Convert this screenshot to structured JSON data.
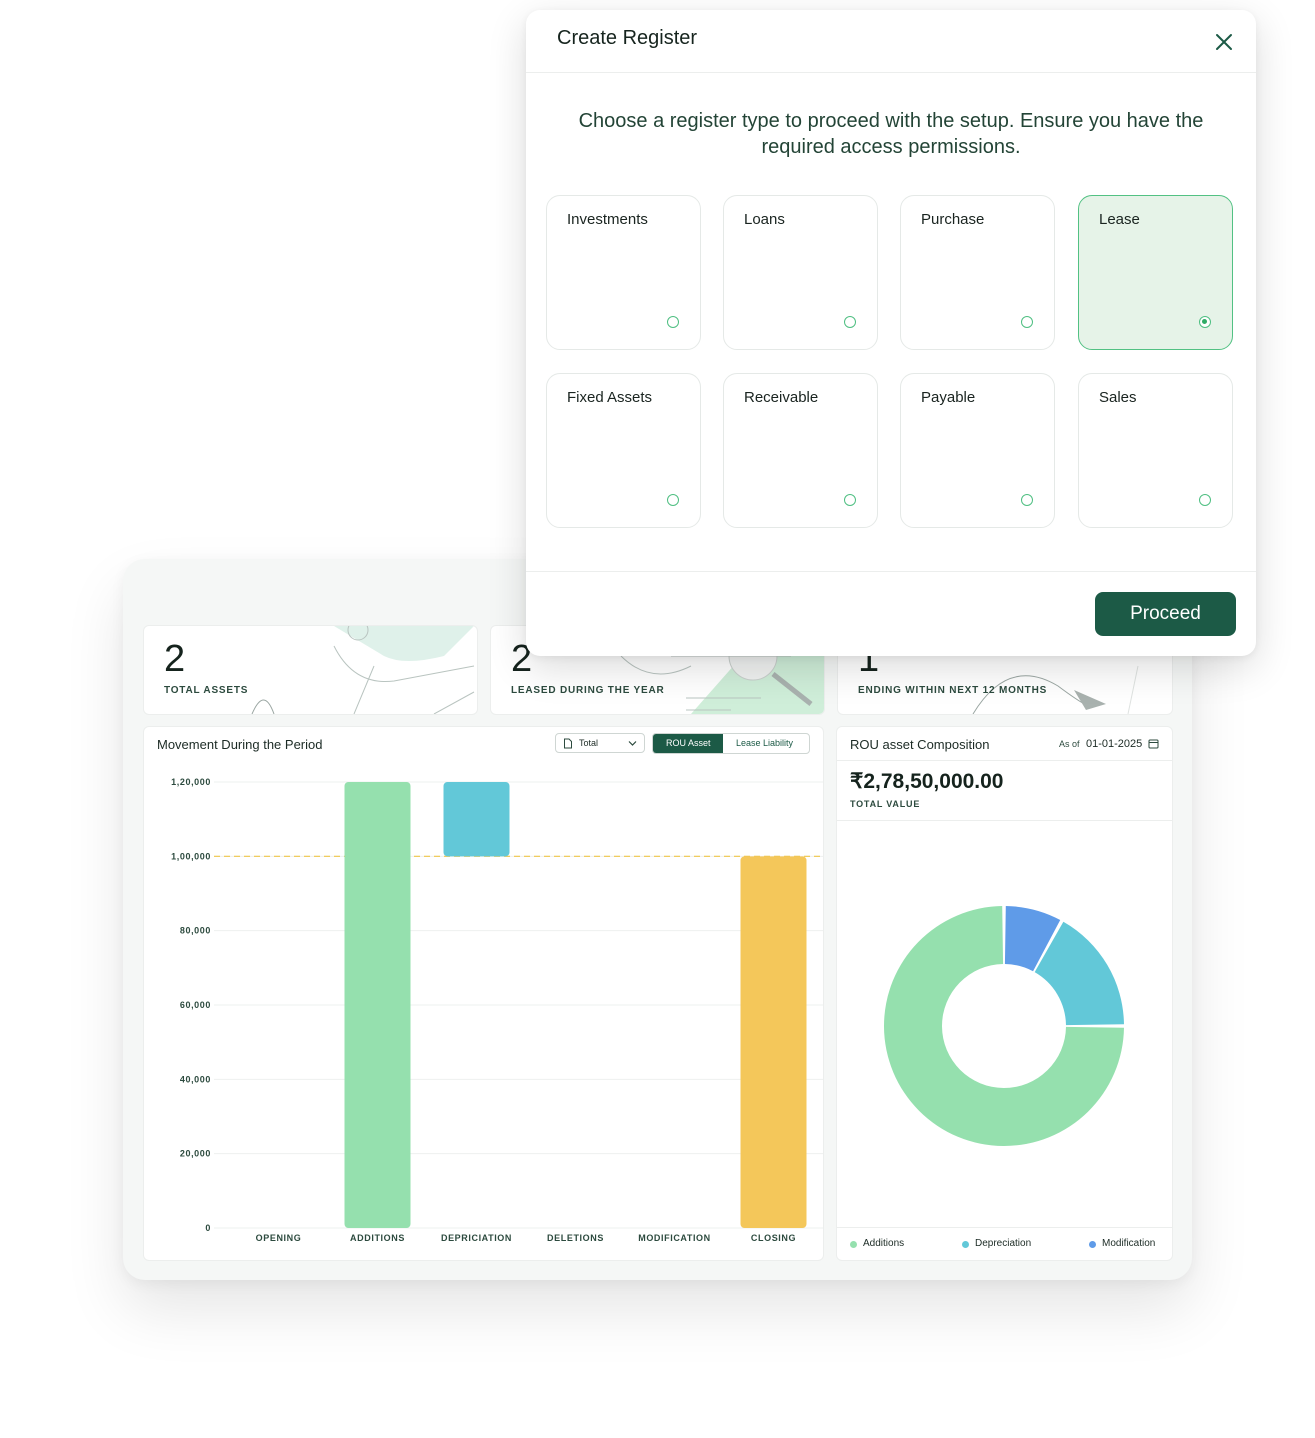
{
  "modal": {
    "title": "Create Register",
    "subtitle": "Choose a register type to proceed with the setup. Ensure you have the required access permissions.",
    "options": [
      {
        "label": "Investments",
        "selected": false
      },
      {
        "label": "Loans",
        "selected": false
      },
      {
        "label": "Purchase",
        "selected": false
      },
      {
        "label": "Lease",
        "selected": true
      },
      {
        "label": "Fixed Assets",
        "selected": false
      },
      {
        "label": "Receivable",
        "selected": false
      },
      {
        "label": "Payable",
        "selected": false
      },
      {
        "label": "Sales",
        "selected": false
      }
    ],
    "proceed_label": "Proceed",
    "close_icon": "close-icon"
  },
  "stats": [
    {
      "value": "2",
      "label": "TOTAL ASSETS"
    },
    {
      "value": "2",
      "label": "LEASED DURING THE YEAR"
    },
    {
      "value": "1",
      "label": "ENDING WITHIN NEXT 12 MONTHS"
    }
  ],
  "movement": {
    "title": "Movement During the Period",
    "dropdown_value": "Total",
    "toggle": [
      "ROU Asset",
      "Lease Liability"
    ],
    "active_toggle": "ROU Asset"
  },
  "composition": {
    "title": "ROU asset Composition",
    "as_of_label": "As of",
    "as_of_date": "01-01-2025",
    "total_value": "₹2,78,50,000.00",
    "total_label": "TOTAL VALUE",
    "legend": [
      {
        "name": "Additions",
        "color": "#95e0ae"
      },
      {
        "name": "Depreciation",
        "color": "#62c8d8"
      },
      {
        "name": "Modification",
        "color": "#5f9be8"
      }
    ]
  },
  "chart_data": [
    {
      "type": "bar",
      "categories": [
        "OPENING",
        "ADDITIONS",
        "DEPRICIATION",
        "DELETIONS",
        "MODIFICATION",
        "CLOSING"
      ],
      "bars": [
        {
          "category": "OPENING",
          "start": 0,
          "end": 0,
          "color": "#95e0ae"
        },
        {
          "category": "ADDITIONS",
          "start": 0,
          "end": 120000,
          "color": "#95e0ae"
        },
        {
          "category": "DEPRICIATION",
          "start": 100000,
          "end": 120000,
          "color": "#62c8d8"
        },
        {
          "category": "DELETIONS",
          "start": 100000,
          "end": 100000,
          "color": "#62c8d8"
        },
        {
          "category": "MODIFICATION",
          "start": 100000,
          "end": 100000,
          "color": "#5f9be8"
        },
        {
          "category": "CLOSING",
          "start": 0,
          "end": 100000,
          "color": "#f4c75a"
        }
      ],
      "y_ticks": [
        "0",
        "20,000",
        "40,000",
        "60,000",
        "80,000",
        "1,00,000",
        "1,20,000"
      ],
      "ylim": [
        0,
        120000
      ],
      "reference_line": 100000,
      "grid": true
    },
    {
      "type": "pie",
      "donut": true,
      "slices": [
        {
          "name": "Additions",
          "value": 75,
          "color": "#95e0ae"
        },
        {
          "name": "Depreciation",
          "value": 17,
          "color": "#62c8d8"
        },
        {
          "name": "Modification",
          "value": 8,
          "color": "#5f9be8"
        }
      ]
    }
  ]
}
